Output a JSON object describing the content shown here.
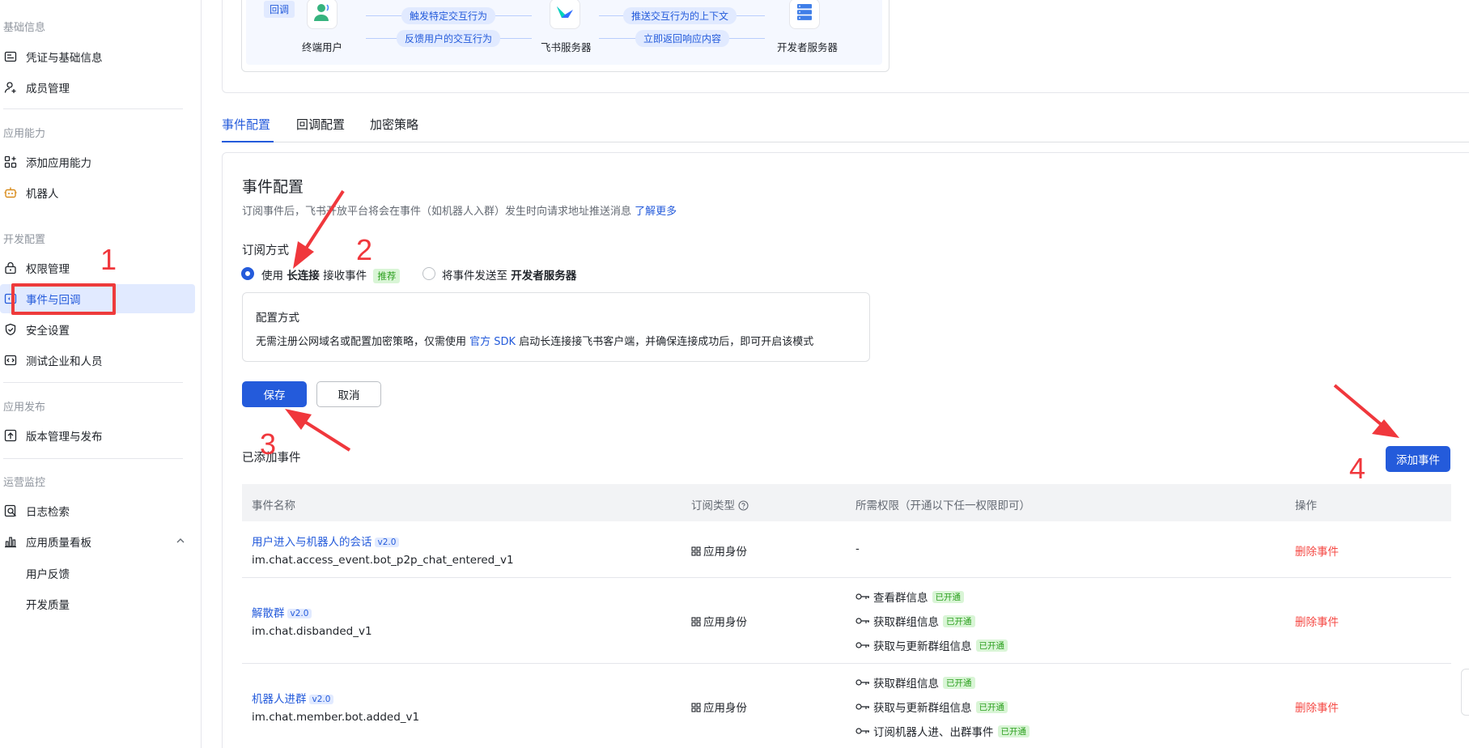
{
  "sidebar": {
    "sections": [
      {
        "title": "基础信息",
        "items": [
          {
            "label": "凭证与基础信息",
            "icon": "credential-icon"
          },
          {
            "label": "成员管理",
            "icon": "user-add-icon"
          }
        ]
      },
      {
        "title": "应用能力",
        "items": [
          {
            "label": "添加应用能力",
            "icon": "grid-plus-icon"
          },
          {
            "label": "机器人",
            "icon": "robot-icon"
          }
        ]
      },
      {
        "title": "开发配置",
        "items": [
          {
            "label": "权限管理",
            "icon": "lock-icon"
          },
          {
            "label": "事件与回调",
            "icon": "event-icon",
            "active": true
          },
          {
            "label": "安全设置",
            "icon": "shield-icon"
          },
          {
            "label": "测试企业和人员",
            "icon": "code-icon"
          }
        ]
      },
      {
        "title": "应用发布",
        "items": [
          {
            "label": "版本管理与发布",
            "icon": "upload-icon"
          }
        ]
      },
      {
        "title": "运营监控",
        "items": [
          {
            "label": "日志检索",
            "icon": "log-search-icon"
          },
          {
            "label": "应用质量看板",
            "icon": "bar-chart-icon",
            "expandable": true
          }
        ]
      }
    ],
    "sub_items": [
      "用户反馈",
      "开发质量"
    ]
  },
  "flow": {
    "tag": "回调",
    "nodes": [
      "终端用户",
      "飞书服务器",
      "开发者服务器"
    ],
    "pills": [
      "触发特定交互行为",
      "反馈用户的交互行为",
      "推送交互行为的上下文",
      "立即返回响应内容"
    ]
  },
  "tabs": [
    "事件配置",
    "回调配置",
    "加密策略"
  ],
  "event_config": {
    "title": "事件配置",
    "description": "订阅事件后，飞书开放平台将会在事件（如机器人入群）发生时向请求地址推送消息",
    "learn_more": "了解更多",
    "subscribe_label": "订阅方式",
    "option1_prefix": "使用",
    "option1_bold": "长连接",
    "option1_suffix": "接收事件",
    "option1_badge": "推荐",
    "option2_prefix": "将事件发送至",
    "option2_bold": "开发者服务器",
    "config_title": "配置方式",
    "config_text_a": "无需注册公网域名或配置加密策略，仅需使用",
    "config_link": "官方 SDK",
    "config_text_b": "启动长连接接飞书客户端，并确保连接成功后，即可开启该模式",
    "save": "保存",
    "cancel": "取消",
    "added_events": "已添加事件",
    "add_event": "添加事件"
  },
  "table": {
    "headers": [
      "事件名称",
      "订阅类型",
      "所需权限（开通以下任一权限即可）",
      "操作"
    ],
    "rows": [
      {
        "name": "用户进入与机器人的会话",
        "version": "v2.0",
        "code": "im.chat.access_event.bot_p2p_chat_entered_v1",
        "type": "应用身份",
        "perms": [
          {
            "label": "-",
            "status": ""
          }
        ],
        "action": "删除事件"
      },
      {
        "name": "解散群",
        "version": "v2.0",
        "code": "im.chat.disbanded_v1",
        "type": "应用身份",
        "perms": [
          {
            "label": "查看群信息",
            "status": "已开通"
          },
          {
            "label": "获取群组信息",
            "status": "已开通"
          },
          {
            "label": "获取与更新群组信息",
            "status": "已开通"
          }
        ],
        "action": "删除事件"
      },
      {
        "name": "机器人进群",
        "version": "v2.0",
        "code": "im.chat.member.bot.added_v1",
        "type": "应用身份",
        "perms": [
          {
            "label": "获取群组信息",
            "status": "已开通"
          },
          {
            "label": "获取与更新群组信息",
            "status": "已开通"
          },
          {
            "label": "订阅机器人进、出群事件",
            "status": "已开通"
          }
        ],
        "action": "删除事件"
      }
    ]
  },
  "annotations": [
    "1",
    "2",
    "3",
    "4"
  ],
  "colors": {
    "primary": "#245bdb",
    "danger": "#f54a45",
    "annotation": "#f0373c",
    "success": "#2ea121"
  }
}
